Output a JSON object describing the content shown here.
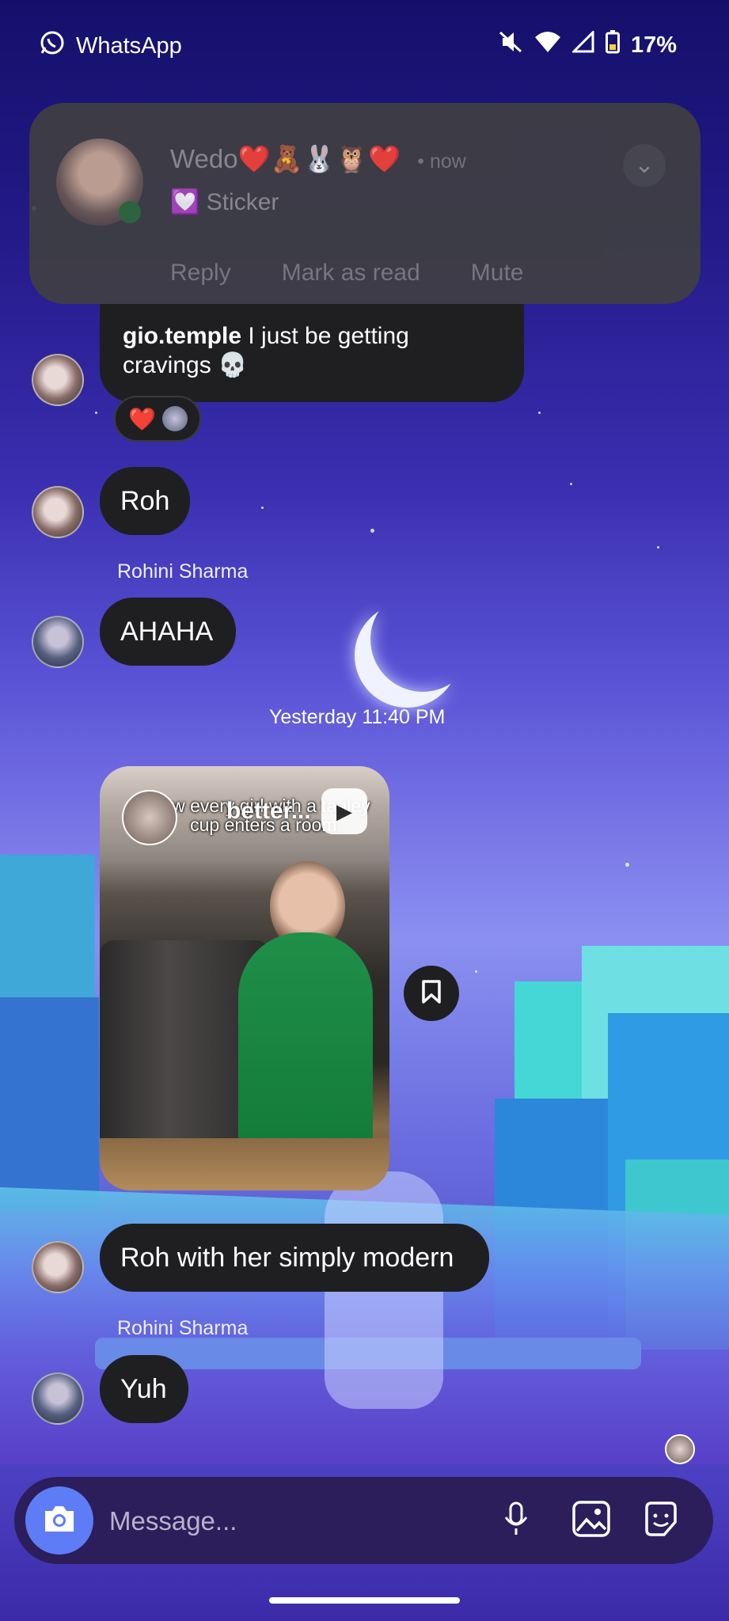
{
  "status_bar": {
    "app_name": "WhatsApp",
    "battery": "17%"
  },
  "notification": {
    "sender": "Wedo❤️🧸🐰🦉❤️",
    "time": "now",
    "message": "💟 Sticker",
    "actions": [
      "Reply",
      "Mark as read",
      "Mute"
    ]
  },
  "chat": {
    "message_1": {
      "username": "gio.temple",
      "text": "I just be getting cravings 💀",
      "reactions": "❤️"
    },
    "message_2": {
      "text": "Roh"
    },
    "sender_1": "Rohini Sharma",
    "message_3": {
      "text": "AHAHA"
    },
    "timestamp": "Yesterday 11:40 PM",
    "reel": {
      "caption": "ow every girl with a tanley cup enters a room:",
      "username": "better..."
    },
    "message_4": {
      "text": "Roh with her simply modern"
    },
    "sender_2": "Rohini Sharma",
    "message_5": {
      "text": "Yuh"
    }
  },
  "composer": {
    "placeholder": "Message..."
  },
  "icons": [
    "whatsapp-icon",
    "mute-icon",
    "wifi-icon",
    "signal-icon",
    "battery-icon",
    "chevron-down-icon",
    "reel-play-icon",
    "bookmark-icon",
    "camera-icon",
    "microphone-icon",
    "gallery-icon",
    "sticker-icon"
  ],
  "colors": {
    "bubble": "#1f1f22",
    "camera_button": "#5f7cf7",
    "composer": "#2b1e5b"
  }
}
